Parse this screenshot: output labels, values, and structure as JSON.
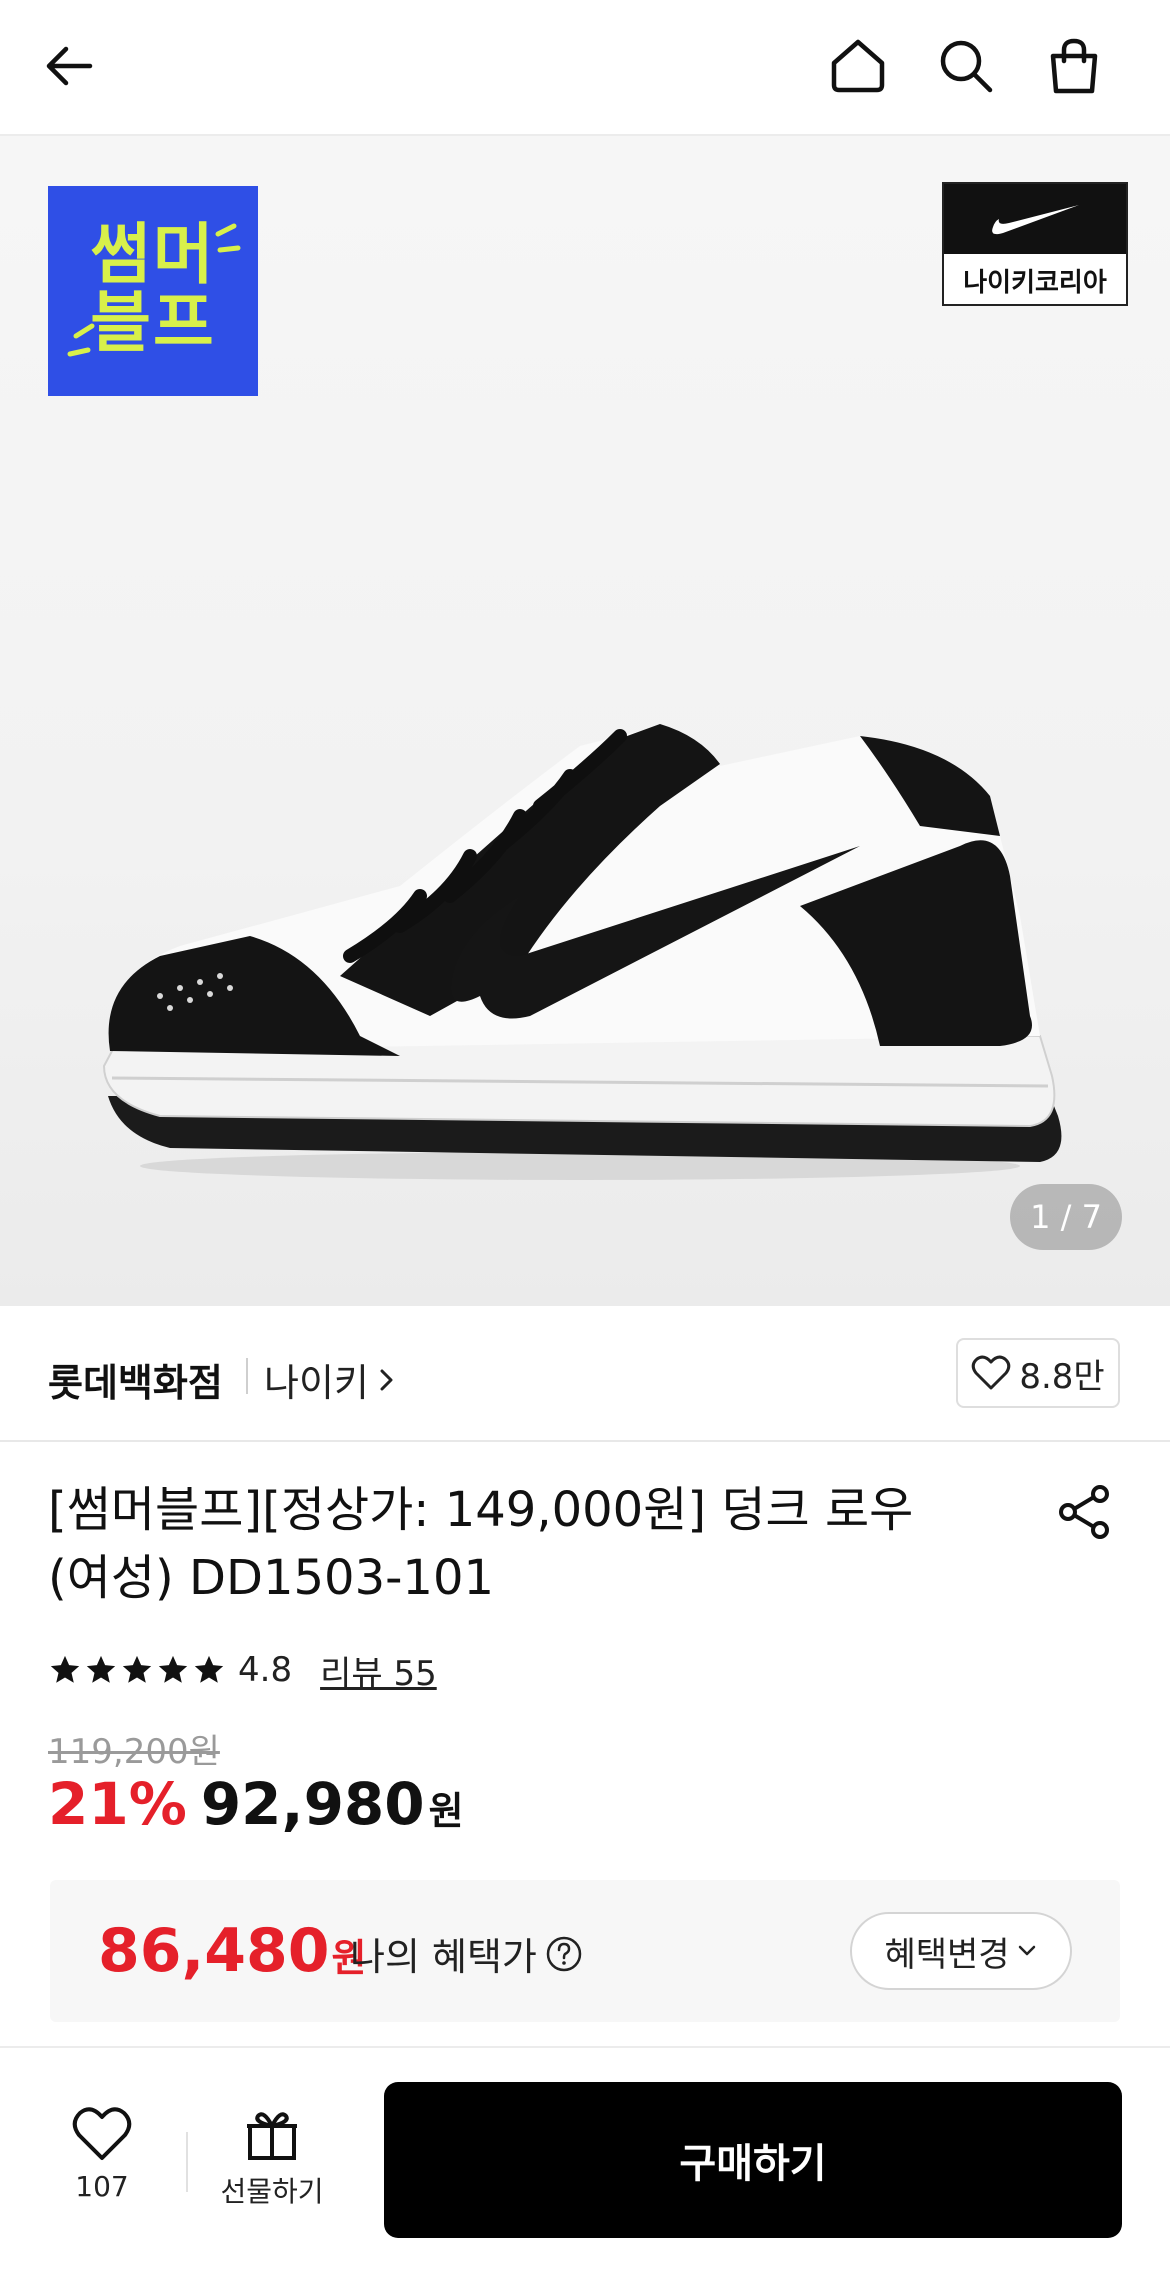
{
  "header": {
    "back_icon": "back-arrow-icon",
    "home_icon": "home-icon",
    "search_icon": "search-icon",
    "bag_icon": "shopping-bag-icon"
  },
  "hero": {
    "promo_badge_line1": "썸머",
    "promo_badge_line2": "블프",
    "brand_badge_label": "나이키코리아",
    "image_counter": "1 / 7",
    "colors": {
      "promo_bg": "#2f4fe6",
      "promo_text": "#d8f04a"
    }
  },
  "store": {
    "name": "롯데백화점",
    "brand": "나이키",
    "likes": "8.8만"
  },
  "product": {
    "title": "[썸머블프][정상가: 149,000원] 덩크 로우 (여성) DD1503-101",
    "rating": "4.8",
    "stars": 5,
    "review_link": "리뷰 55",
    "original_price": "119,200원",
    "discount": "21%",
    "price": "92,980",
    "price_unit": "원"
  },
  "benefit": {
    "price": "86,480",
    "price_unit": "원",
    "label": "나의 혜택가",
    "change_button": "혜택변경"
  },
  "bottom_bar": {
    "wish_count": "107",
    "gift_label": "선물하기",
    "buy_label": "구매하기",
    "colors": {
      "accent_red": "#e5202a",
      "buy_bg": "#000000"
    }
  }
}
